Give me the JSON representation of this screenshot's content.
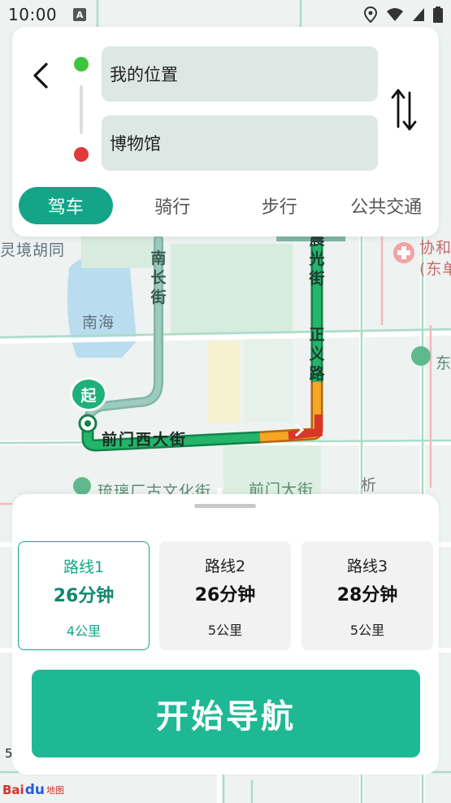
{
  "status_bar": {
    "time": "10:00",
    "a_icon": "A"
  },
  "map": {
    "labels": {
      "boundary_hutong": "灵境胡同",
      "nanhai": "南海",
      "nanchang_street": "南长街",
      "qianmen_west": "前门西大街",
      "zhengyi_road": "正义路",
      "chenguang_street": "晨光街",
      "liulichang": "琉璃厂古文化街",
      "qianmen_street": "前门大街",
      "xiehe": "协和",
      "dongdan": "(东单",
      "dong": "东",
      "xi": "析",
      "start_marker": "起",
      "scale": "5"
    }
  },
  "top_panel": {
    "from_value": "我的位置",
    "to_value": "博物馆",
    "modes": [
      "驾车",
      "骑行",
      "步行",
      "公共交通"
    ],
    "active_mode": "驾车"
  },
  "routes": [
    {
      "name": "路线1",
      "time": "26分钟",
      "distance": "4公里",
      "selected": true
    },
    {
      "name": "路线2",
      "time": "26分钟",
      "distance": "5公里",
      "selected": false
    },
    {
      "name": "路线3",
      "time": "28分钟",
      "distance": "5公里",
      "selected": false
    }
  ],
  "start_button": "开始导航",
  "logo": {
    "left": "Bai",
    "paw": "du",
    "right": "地图"
  },
  "colors": {
    "accent": "#14a589",
    "start_button": "#1fb895",
    "route_green": "#1aa35a",
    "route_orange": "#f5a623",
    "route_red": "#d9362a"
  }
}
